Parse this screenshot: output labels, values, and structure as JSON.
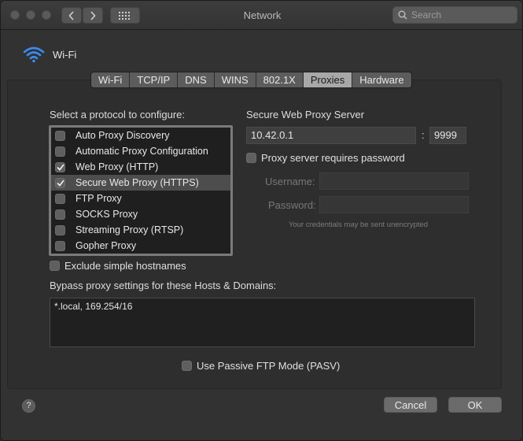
{
  "window": {
    "title": "Network"
  },
  "search": {
    "placeholder": "Search"
  },
  "interface": {
    "name": "Wi-Fi",
    "icon": "wifi-icon"
  },
  "tabs": [
    {
      "label": "Wi-Fi"
    },
    {
      "label": "TCP/IP"
    },
    {
      "label": "DNS"
    },
    {
      "label": "WINS"
    },
    {
      "label": "802.1X"
    },
    {
      "label": "Proxies",
      "active": true
    },
    {
      "label": "Hardware"
    }
  ],
  "protocols": {
    "heading": "Select a protocol to configure:",
    "items": [
      {
        "label": "Auto Proxy Discovery",
        "checked": false
      },
      {
        "label": "Automatic Proxy Configuration",
        "checked": false
      },
      {
        "label": "Web Proxy (HTTP)",
        "checked": true
      },
      {
        "label": "Secure Web Proxy (HTTPS)",
        "checked": true,
        "selected": true
      },
      {
        "label": "FTP Proxy",
        "checked": false
      },
      {
        "label": "SOCKS Proxy",
        "checked": false
      },
      {
        "label": "Streaming Proxy (RTSP)",
        "checked": false
      },
      {
        "label": "Gopher Proxy",
        "checked": false
      }
    ]
  },
  "server": {
    "heading": "Secure Web Proxy Server",
    "host": "10.42.0.1",
    "separator": ":",
    "port": "9999",
    "requires_password_label": "Proxy server requires password",
    "requires_password": false,
    "username_label": "Username:",
    "password_label": "Password:",
    "hint": "Your credentials may be sent unencrypted"
  },
  "exclude_simple": {
    "label": "Exclude simple hostnames",
    "checked": false
  },
  "bypass": {
    "heading": "Bypass proxy settings for these Hosts & Domains:",
    "value": "*.local, 169.254/16"
  },
  "passive_ftp": {
    "label": "Use Passive FTP Mode (PASV)",
    "checked": false
  },
  "buttons": {
    "help": "?",
    "cancel": "Cancel",
    "ok": "OK"
  },
  "colors": {
    "window_bg": "#323232",
    "list_bg": "#1f1f1f",
    "active_tab": "#a8a8a8"
  }
}
